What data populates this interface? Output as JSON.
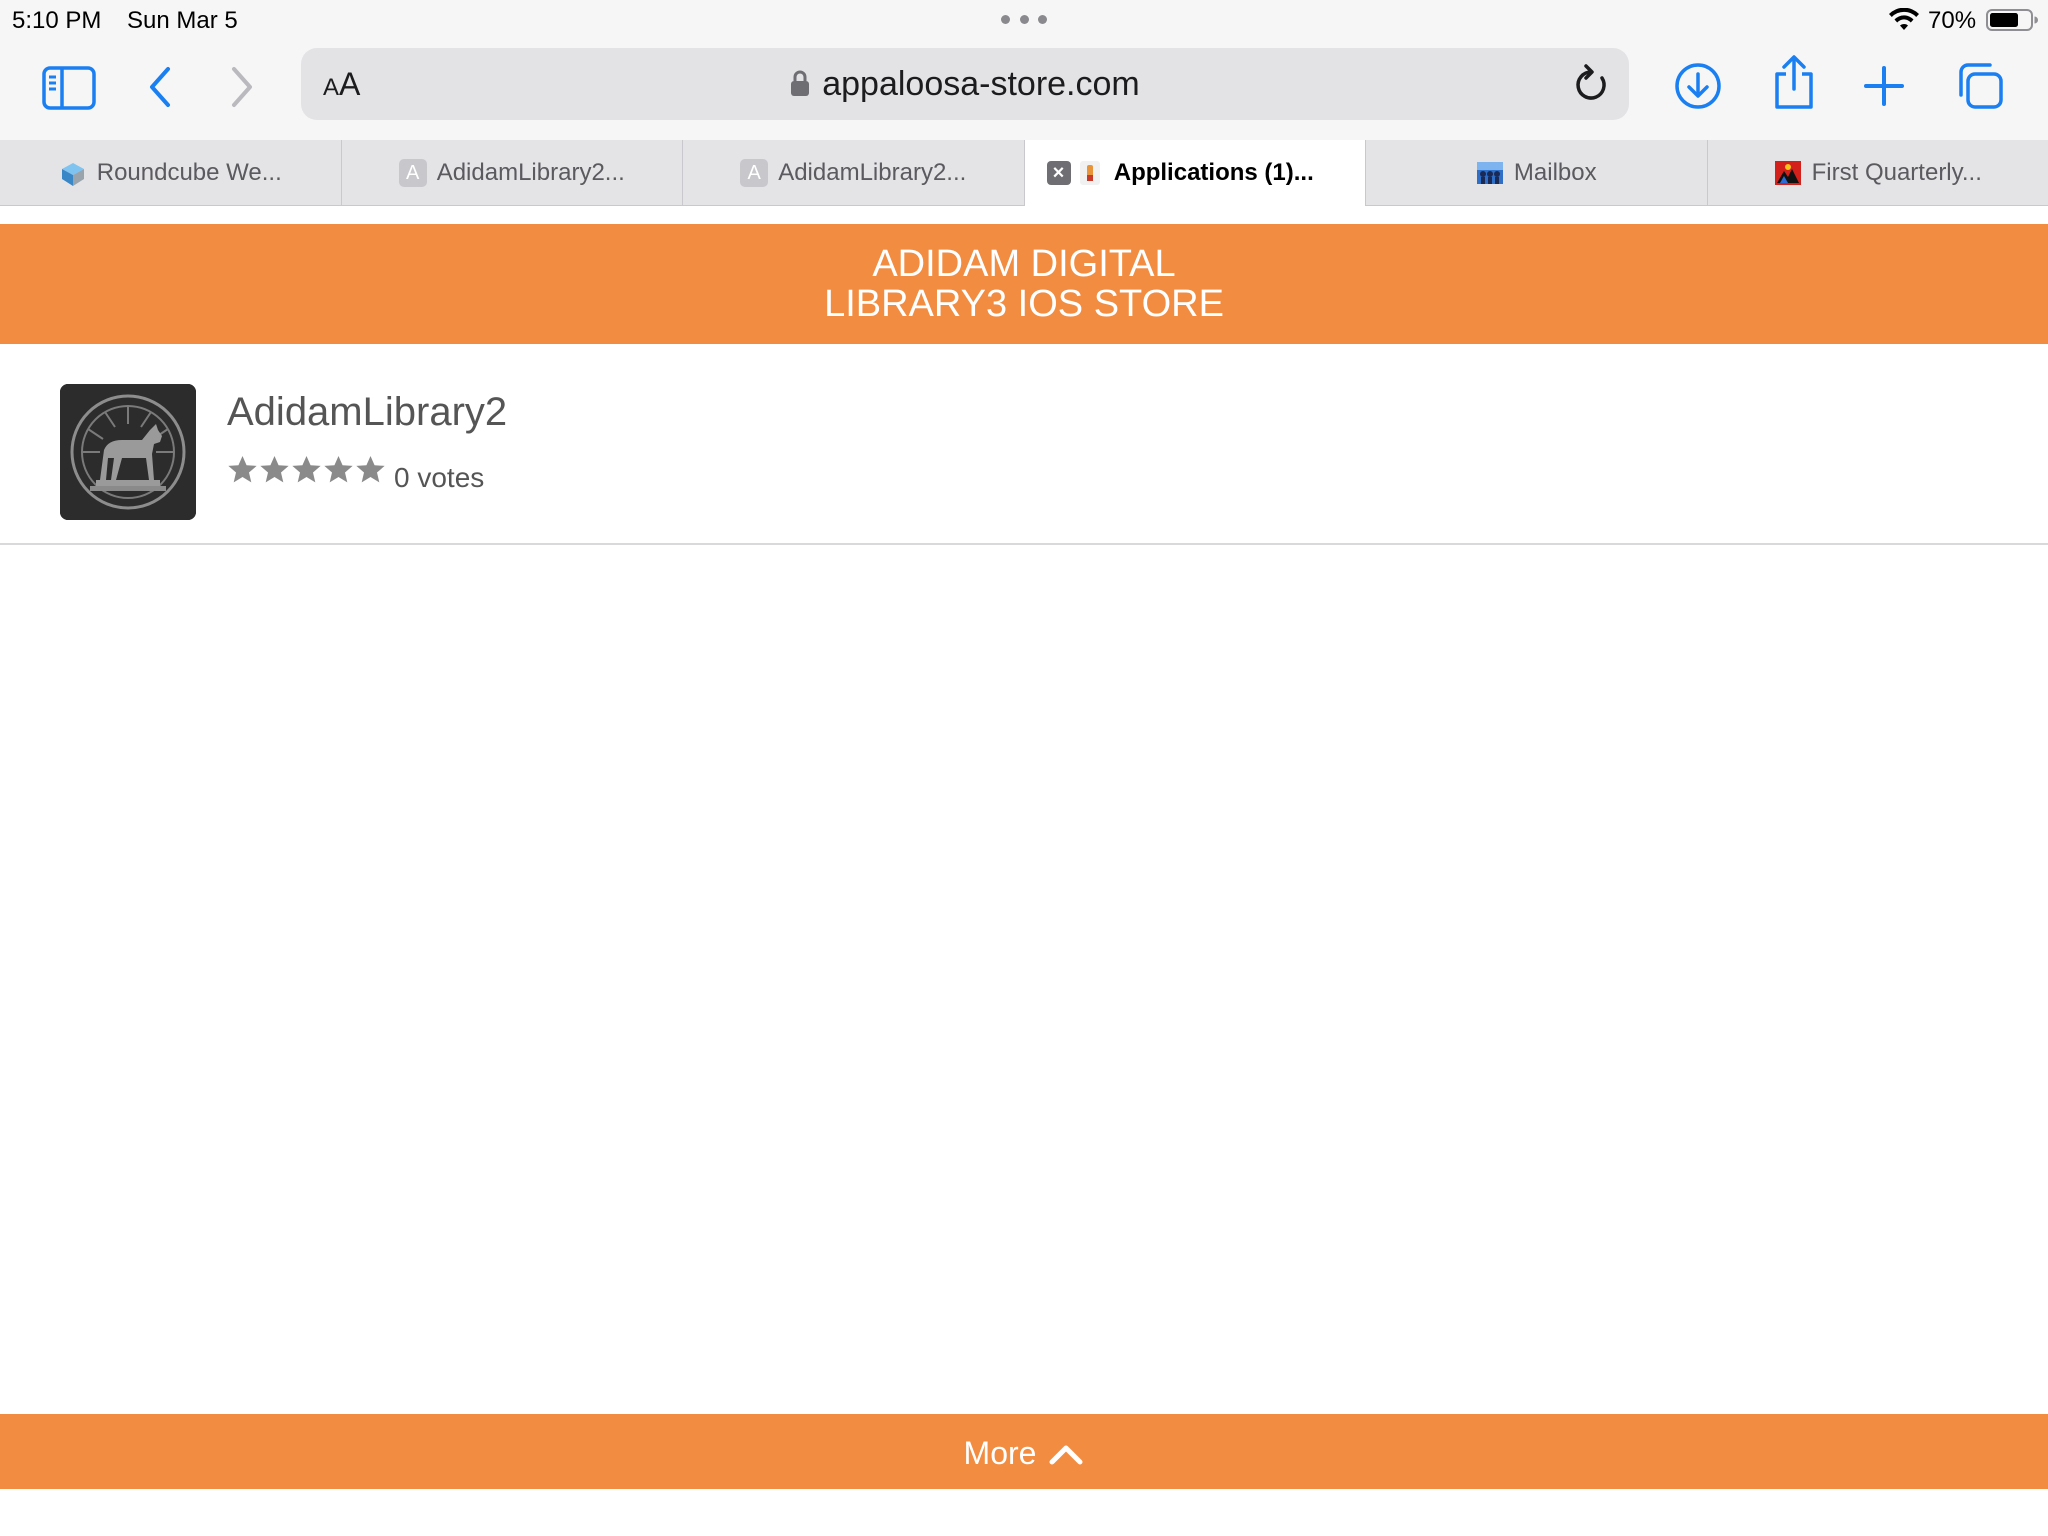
{
  "status_bar": {
    "time": "5:10 PM",
    "date": "Sun Mar 5",
    "battery_percent": "70%"
  },
  "toolbar": {
    "aa_label_small": "A",
    "aa_label_large": "A",
    "url": "appaloosa-store.com"
  },
  "tabs": [
    {
      "label": "Roundcube We...",
      "favicon": "roundcube-logo-icon"
    },
    {
      "label": "AdidamLibrary2...",
      "favicon_letter": "A"
    },
    {
      "label": "AdidamLibrary2...",
      "favicon_letter": "A"
    },
    {
      "label": "Applications (1)...",
      "favicon": "appaloosa-favicon-icon",
      "active": true
    },
    {
      "label": "Mailbox",
      "favicon": "mailbox-favicon-icon"
    },
    {
      "label": "First Quarterly...",
      "favicon": "red-flag-favicon-icon"
    }
  ],
  "store": {
    "header_line1": "ADIDAM DIGITAL",
    "header_line2": "LIBRARY3 IOS STORE",
    "accent_color": "#f28c40"
  },
  "apps": [
    {
      "name": "AdidamLibrary2",
      "rating_stars": 0,
      "rating_max": 5,
      "votes": "0 votes",
      "icon": "horse-emblem-icon"
    }
  ],
  "footer": {
    "more_label": "More"
  }
}
